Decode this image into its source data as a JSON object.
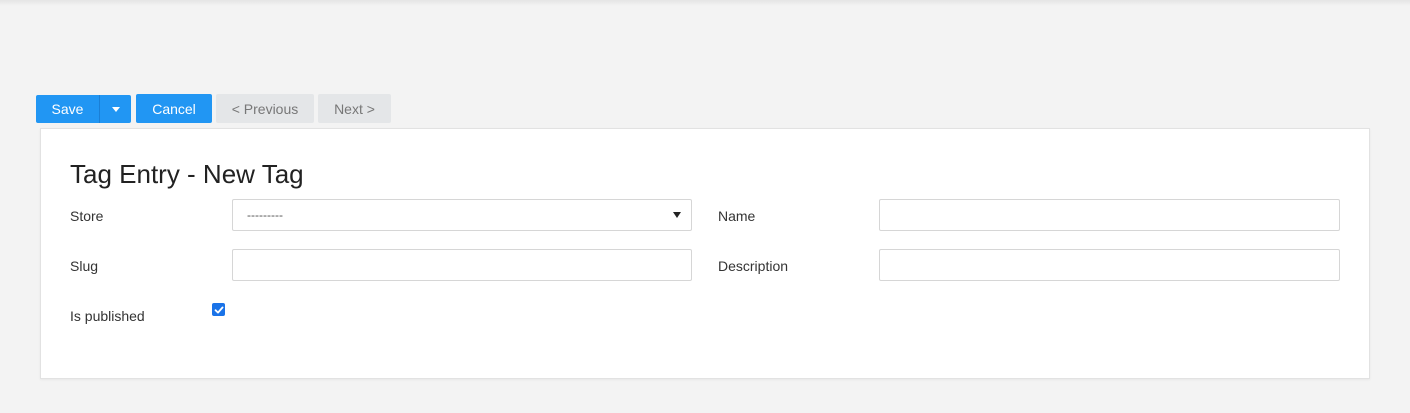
{
  "toolbar": {
    "save_label": "Save",
    "cancel_label": "Cancel",
    "previous_label": "< Previous",
    "next_label": "Next >"
  },
  "form": {
    "title": "Tag Entry - New Tag",
    "store": {
      "label": "Store",
      "value": "---------"
    },
    "name": {
      "label": "Name",
      "value": ""
    },
    "slug": {
      "label": "Slug",
      "value": ""
    },
    "description": {
      "label": "Description",
      "value": ""
    },
    "is_published": {
      "label": "Is published",
      "checked": true
    }
  },
  "colors": {
    "primary": "#2196f3",
    "nav_button_bg": "#e4e6e8",
    "page_bg": "#f3f3f3",
    "checkbox": "#1a73e8"
  }
}
